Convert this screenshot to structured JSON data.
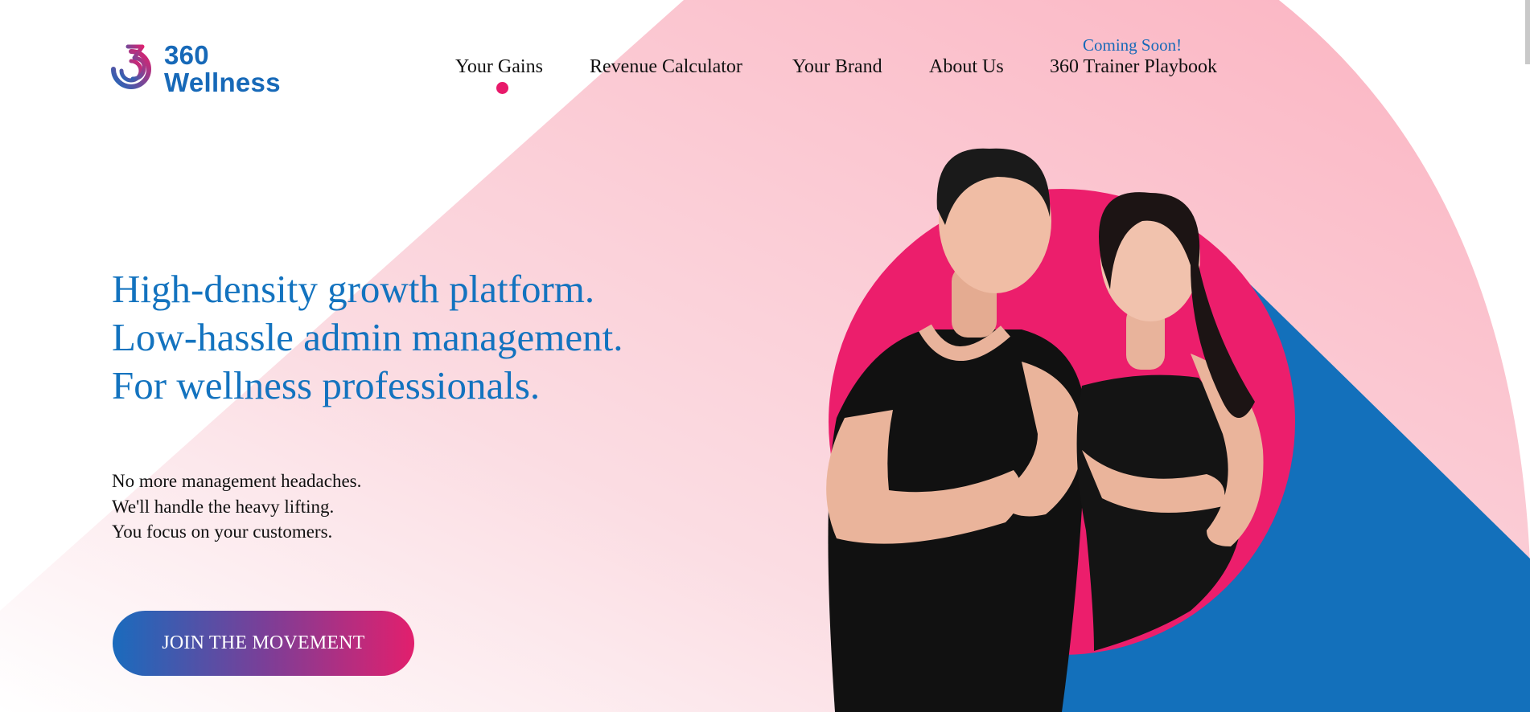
{
  "brand": {
    "name_line1": "360",
    "name_line2": "Wellness",
    "colors": {
      "blue": "#1769b8",
      "pink": "#e8196a",
      "text": "#111111"
    }
  },
  "nav": {
    "items": [
      {
        "label": "Your Gains",
        "active": true
      },
      {
        "label": "Revenue Calculator"
      },
      {
        "label": "Your Brand"
      },
      {
        "label": "About Us"
      },
      {
        "label": "360 Trainer Playbook"
      }
    ],
    "badge": "Coming Soon!"
  },
  "hero": {
    "title_lines": [
      "High-density growth platform.",
      "Low-hassle admin management.",
      "For wellness professionals."
    ],
    "sub_lines": [
      "No more management headaches.",
      "We'll handle the heavy lifting.",
      "You focus on your customers."
    ],
    "cta": "JOIN THE MOVEMENT"
  }
}
